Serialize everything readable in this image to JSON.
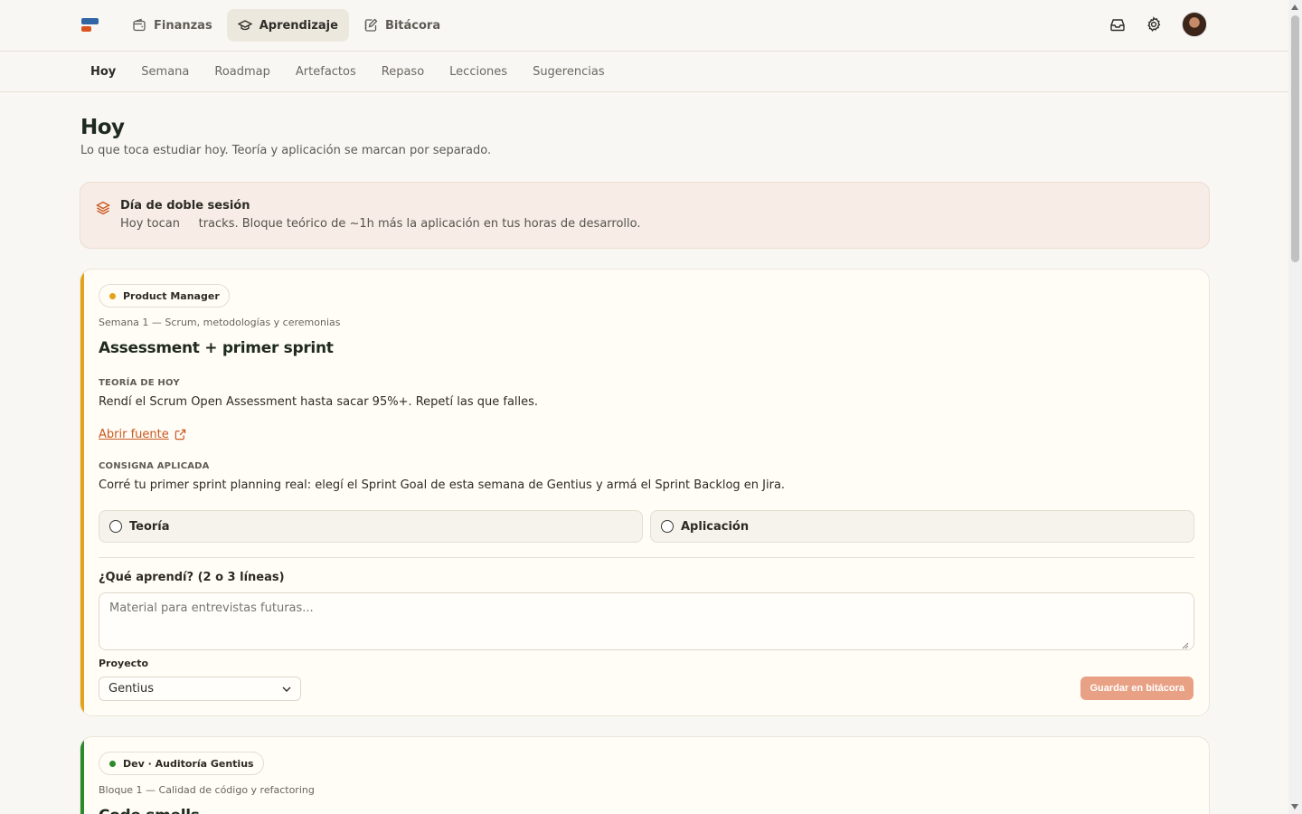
{
  "topnav": {
    "items": [
      {
        "label": "Finanzas",
        "icon": "wallet-icon"
      },
      {
        "label": "Aprendizaje",
        "icon": "graduation-cap-icon",
        "active": true
      },
      {
        "label": "Bitácora",
        "icon": "notebook-pen-icon"
      }
    ]
  },
  "subnav": {
    "items": [
      {
        "label": "Hoy",
        "active": true
      },
      {
        "label": "Semana"
      },
      {
        "label": "Roadmap"
      },
      {
        "label": "Artefactos"
      },
      {
        "label": "Repaso"
      },
      {
        "label": "Lecciones"
      },
      {
        "label": "Sugerencias"
      }
    ]
  },
  "page": {
    "title": "Hoy",
    "subtitle": "Lo que toca estudiar hoy. Teoría y aplicación se marcan por separado."
  },
  "banner": {
    "title": "Día de doble sesión",
    "text": "Hoy tocan     tracks. Bloque teórico de ~1h más la aplicación en tus horas de desarrollo."
  },
  "cards": [
    {
      "badge": "Product Manager",
      "week": "Semana 1 — Scrum, metodologías y ceremonias",
      "title": "Assessment + primer sprint",
      "theory_label": "TEORÍA DE HOY",
      "theory_text": "Rendí el Scrum Open Assessment hasta sacar 95%+. Repetí las que falles.",
      "source_link": "Abrir fuente",
      "applied_label": "CONSIGNA APLICADA",
      "applied_text": "Corré tu primer sprint planning real: elegí el Sprint Goal de esta semana de Gentius y armá el Sprint Backlog en Jira.",
      "check_theory": "Teoría",
      "check_applied": "Aplicación",
      "learn_label": "¿Qué aprendí? (2 o 3 líneas)",
      "learn_placeholder": "Material para entrevistas futuras...",
      "project_label": "Proyecto",
      "project_value": "Gentius",
      "save_label": "Guardar en bitácora"
    },
    {
      "badge": "Dev · Auditoría Gentius",
      "week": "Bloque 1 — Calidad de código y refactoring",
      "title": "Code smells"
    }
  ],
  "colors": {
    "accent_orange": "#c9571e",
    "pm_track": "#e2a21b",
    "dev_track": "#2b8a2b",
    "save_button": "#e8a184"
  }
}
